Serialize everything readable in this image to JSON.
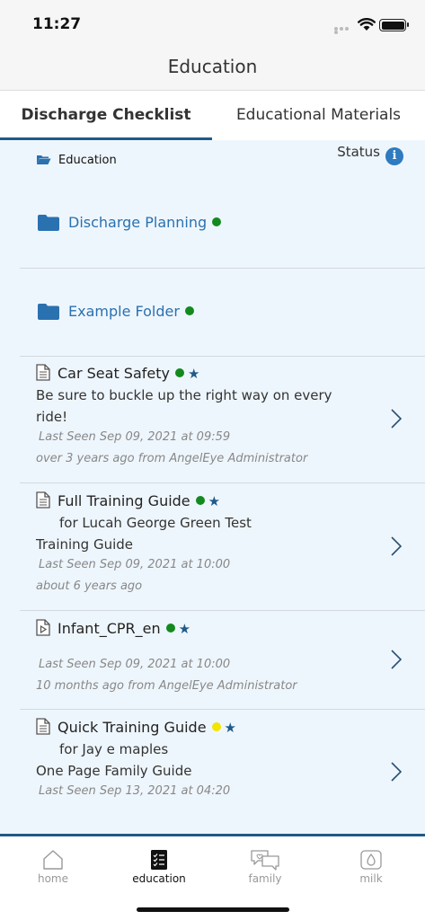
{
  "status_bar": {
    "time": "11:27"
  },
  "nav": {
    "title": "Education"
  },
  "tabs": [
    {
      "label": "Discharge Checklist",
      "active": true
    },
    {
      "label": "Educational Materials",
      "active": false
    }
  ],
  "breadcrumb": {
    "label": "Education"
  },
  "status_header": {
    "label": "Status",
    "icon": "i"
  },
  "folders": [
    {
      "name": "Discharge Planning",
      "status_color": "#138a1e"
    },
    {
      "name": "Example Folder",
      "status_color": "#138a1e"
    }
  ],
  "items": [
    {
      "title": "Car Seat Safety",
      "icon": "document-icon",
      "status_color": "#138a1e",
      "star": "★",
      "line2": "Be sure to buckle up the right way on every",
      "line3": "ride!",
      "last_seen": "Last Seen Sep 09, 2021 at 09:59",
      "ago": "over 3 years ago from AngelEye Administrator"
    },
    {
      "title": "Full Training Guide",
      "icon": "document-icon",
      "status_color": "#138a1e",
      "star": "★",
      "line2": "for Lucah George Green Test",
      "line3": "Training Guide",
      "last_seen": "Last Seen Sep 09, 2021 at 10:00",
      "ago": "about 6 years ago"
    },
    {
      "title": "Infant_CPR_en",
      "icon": "video-icon",
      "status_color": "#138a1e",
      "star": "★",
      "last_seen": "Last Seen Sep 09, 2021 at 10:00",
      "ago": "10 months ago from AngelEye Administrator"
    },
    {
      "title": "Quick Training Guide",
      "icon": "document-icon",
      "status_color": "#f2e500",
      "star": "★",
      "line2": "for Jay e maples",
      "line3": "One Page Family Guide",
      "last_seen": "Last Seen Sep 13, 2021 at 04:20"
    }
  ],
  "tabbar": [
    {
      "label": "home",
      "icon": "home-icon",
      "active": false
    },
    {
      "label": "education",
      "icon": "checklist-icon",
      "active": true
    },
    {
      "label": "family",
      "icon": "chat-icon",
      "active": false
    },
    {
      "label": "milk",
      "icon": "milk-drop-icon",
      "active": false
    }
  ],
  "colors": {
    "accent": "#1f5a89",
    "link": "#2a71b0",
    "content_bg": "#eef6fd",
    "green": "#138a1e",
    "yellow": "#f2e500"
  }
}
